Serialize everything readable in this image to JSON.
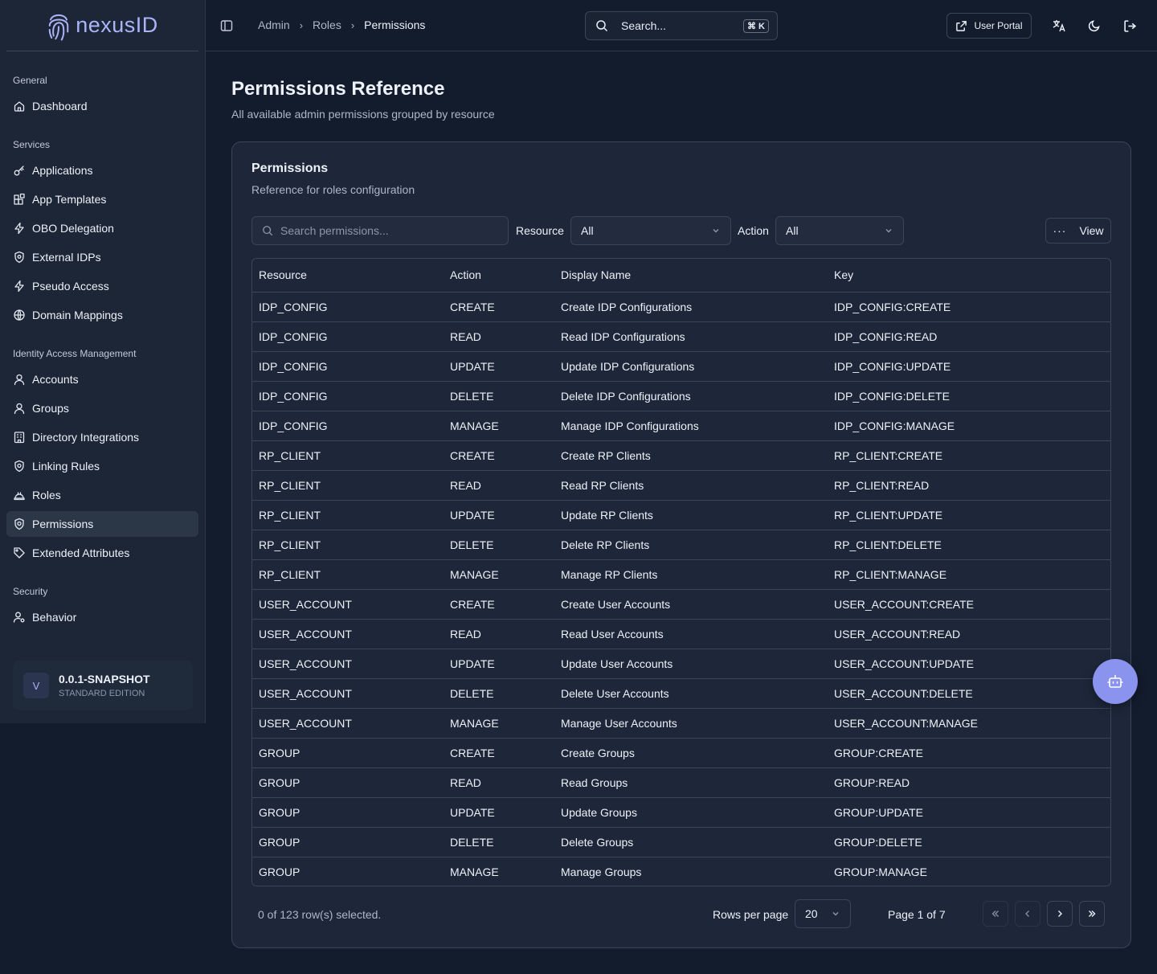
{
  "brand": {
    "name": "nexusID"
  },
  "sidebar": {
    "sections": [
      {
        "label": "General",
        "items": [
          {
            "label": "Dashboard",
            "icon": "home-icon"
          }
        ]
      },
      {
        "label": "Services",
        "items": [
          {
            "label": "Applications",
            "icon": "key-icon"
          },
          {
            "label": "App Templates",
            "icon": "blocks-icon"
          },
          {
            "label": "OBO Delegation",
            "icon": "zap-icon"
          },
          {
            "label": "External IDPs",
            "icon": "shield-icon"
          },
          {
            "label": "Pseudo Access",
            "icon": "zap-icon"
          },
          {
            "label": "Domain Mappings",
            "icon": "globe-icon"
          }
        ]
      },
      {
        "label": "Identity Access Management",
        "items": [
          {
            "label": "Accounts",
            "icon": "user-icon"
          },
          {
            "label": "Groups",
            "icon": "user-icon"
          },
          {
            "label": "Directory Integrations",
            "icon": "building-icon"
          },
          {
            "label": "Linking Rules",
            "icon": "shield-cog-icon"
          },
          {
            "label": "Roles",
            "icon": "hardhat-icon"
          },
          {
            "label": "Permissions",
            "icon": "shield-cog-icon",
            "active": true
          },
          {
            "label": "Extended Attributes",
            "icon": "tag-icon"
          }
        ]
      },
      {
        "label": "Security",
        "items": [
          {
            "label": "Behavior",
            "icon": "user-cog-icon"
          }
        ]
      }
    ],
    "version": {
      "badge": "V",
      "title": "0.0.1-SNAPSHOT",
      "subtitle": "STANDARD EDITION"
    }
  },
  "header": {
    "breadcrumb": [
      "Admin",
      "Roles",
      "Permissions"
    ],
    "search_label": "Search...",
    "search_shortcut": "⌘ K",
    "user_portal_label": "User Portal"
  },
  "page": {
    "title": "Permissions Reference",
    "subtitle": "All available admin permissions grouped by resource"
  },
  "card": {
    "title": "Permissions",
    "subtitle": "Reference for roles configuration",
    "search_placeholder": "Search permissions...",
    "resource_label": "Resource",
    "resource_value": "All",
    "action_label": "Action",
    "action_value": "All",
    "view_label": "View"
  },
  "table": {
    "columns": [
      "Resource",
      "Action",
      "Display Name",
      "Key"
    ],
    "rows": [
      [
        "IDP_CONFIG",
        "CREATE",
        "Create IDP Configurations",
        "IDP_CONFIG:CREATE"
      ],
      [
        "IDP_CONFIG",
        "READ",
        "Read IDP Configurations",
        "IDP_CONFIG:READ"
      ],
      [
        "IDP_CONFIG",
        "UPDATE",
        "Update IDP Configurations",
        "IDP_CONFIG:UPDATE"
      ],
      [
        "IDP_CONFIG",
        "DELETE",
        "Delete IDP Configurations",
        "IDP_CONFIG:DELETE"
      ],
      [
        "IDP_CONFIG",
        "MANAGE",
        "Manage IDP Configurations",
        "IDP_CONFIG:MANAGE"
      ],
      [
        "RP_CLIENT",
        "CREATE",
        "Create RP Clients",
        "RP_CLIENT:CREATE"
      ],
      [
        "RP_CLIENT",
        "READ",
        "Read RP Clients",
        "RP_CLIENT:READ"
      ],
      [
        "RP_CLIENT",
        "UPDATE",
        "Update RP Clients",
        "RP_CLIENT:UPDATE"
      ],
      [
        "RP_CLIENT",
        "DELETE",
        "Delete RP Clients",
        "RP_CLIENT:DELETE"
      ],
      [
        "RP_CLIENT",
        "MANAGE",
        "Manage RP Clients",
        "RP_CLIENT:MANAGE"
      ],
      [
        "USER_ACCOUNT",
        "CREATE",
        "Create User Accounts",
        "USER_ACCOUNT:CREATE"
      ],
      [
        "USER_ACCOUNT",
        "READ",
        "Read User Accounts",
        "USER_ACCOUNT:READ"
      ],
      [
        "USER_ACCOUNT",
        "UPDATE",
        "Update User Accounts",
        "USER_ACCOUNT:UPDATE"
      ],
      [
        "USER_ACCOUNT",
        "DELETE",
        "Delete User Accounts",
        "USER_ACCOUNT:DELETE"
      ],
      [
        "USER_ACCOUNT",
        "MANAGE",
        "Manage User Accounts",
        "USER_ACCOUNT:MANAGE"
      ],
      [
        "GROUP",
        "CREATE",
        "Create Groups",
        "GROUP:CREATE"
      ],
      [
        "GROUP",
        "READ",
        "Read Groups",
        "GROUP:READ"
      ],
      [
        "GROUP",
        "UPDATE",
        "Update Groups",
        "GROUP:UPDATE"
      ],
      [
        "GROUP",
        "DELETE",
        "Delete Groups",
        "GROUP:DELETE"
      ],
      [
        "GROUP",
        "MANAGE",
        "Manage Groups",
        "GROUP:MANAGE"
      ]
    ]
  },
  "footer": {
    "selection": "0 of 123 row(s) selected.",
    "rows_per_page_label": "Rows per page",
    "rows_per_page_value": "20",
    "page_info": "Page 1 of 7"
  },
  "colors": {
    "accent": "#8a93ee",
    "background": "#131c2d",
    "sidebar": "#1c2637"
  }
}
